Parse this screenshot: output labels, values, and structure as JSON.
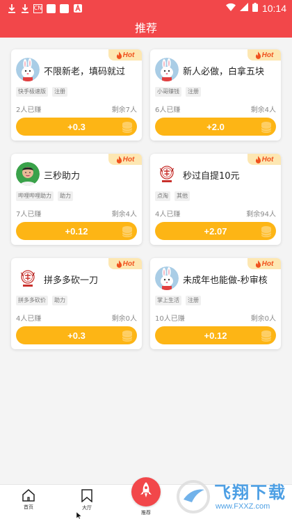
{
  "status_bar": {
    "time": "10:14",
    "badge": "CN"
  },
  "header": {
    "title": "推荐"
  },
  "hot_label": "Hot",
  "tasks": [
    {
      "title": "不限新老，填码就过",
      "tags": [
        "快手极速版",
        "注册"
      ],
      "earned": "2人已赚",
      "remaining": "剩余7人",
      "reward": "+0.3",
      "avatar": "rabbit"
    },
    {
      "title": "新人必做，白拿五块",
      "tags": [
        "小哥赚钱",
        "注册"
      ],
      "earned": "6人已赚",
      "remaining": "剩余4人",
      "reward": "+2.0",
      "avatar": "rabbit"
    },
    {
      "title": "三秒助力",
      "tags": [
        "哔哩哔哩助力",
        "助力"
      ],
      "earned": "7人已赚",
      "remaining": "剩余4人",
      "reward": "+0.12",
      "avatar": "person"
    },
    {
      "title": "秒过自提10元",
      "tags": [
        "点淘",
        "其他"
      ],
      "earned": "4人已赚",
      "remaining": "剩余94人",
      "reward": "+2.07",
      "avatar": "seal"
    },
    {
      "title": "拼多多砍一刀",
      "tags": [
        "拼多多砍价",
        "助力"
      ],
      "earned": "4人已赚",
      "remaining": "剩余0人",
      "reward": "+0.3",
      "avatar": "seal"
    },
    {
      "title": "未成年也能做-秒审核",
      "tags": [
        "掌上生活",
        "注册"
      ],
      "earned": "10人已赚",
      "remaining": "剩余0人",
      "reward": "+0.12",
      "avatar": "rabbit"
    }
  ],
  "bottom_nav": {
    "home": "首页",
    "hall": "大厅",
    "recommend": "推荐"
  },
  "watermark": {
    "text": "飞翔下载",
    "url": "www.FXXZ.com"
  },
  "colors": {
    "brand_red": "#f2474a",
    "reward_yellow": "#fdb515",
    "hot_bg": "#fde7b2",
    "hot_text": "#f0521e"
  }
}
